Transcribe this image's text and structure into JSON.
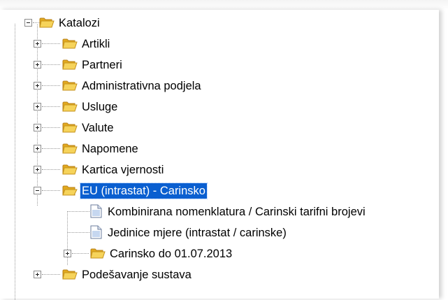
{
  "tree": {
    "root": {
      "label": "Katalozi",
      "expanded": true,
      "icon": "folder-icon"
    },
    "items": [
      {
        "label": "Artikli",
        "expanded": false,
        "icon": "folder-icon"
      },
      {
        "label": "Partneri",
        "expanded": false,
        "icon": "folder-icon"
      },
      {
        "label": "Administrativna podjela",
        "expanded": false,
        "icon": "folder-icon"
      },
      {
        "label": "Usluge",
        "expanded": false,
        "icon": "folder-icon"
      },
      {
        "label": "Valute",
        "expanded": false,
        "icon": "folder-icon"
      },
      {
        "label": "Napomene",
        "expanded": false,
        "icon": "folder-icon"
      },
      {
        "label": "Kartica vjernosti",
        "expanded": false,
        "icon": "folder-icon"
      },
      {
        "label": "EU (intrastat) - Carinsko",
        "expanded": true,
        "selected": true,
        "icon": "folder-icon",
        "children": [
          {
            "label": "Kombinirana nomenklatura / Carinski tarifni brojevi",
            "icon": "document-icon"
          },
          {
            "label": "Jedinice mjere (intrastat / carinske)",
            "icon": "document-icon"
          },
          {
            "label": "Carinsko do 01.07.2013",
            "expanded": false,
            "icon": "folder-icon"
          }
        ]
      },
      {
        "label": "Podešavanje sustava",
        "expanded": false,
        "icon": "folder-icon"
      }
    ]
  },
  "colors": {
    "selection": "#0a5fd0",
    "folder": "#f3c542",
    "line": "#9a9a9a"
  }
}
